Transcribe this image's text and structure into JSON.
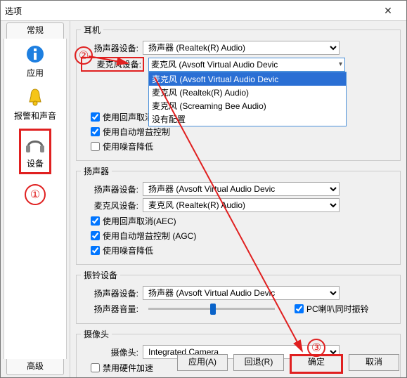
{
  "window": {
    "title": "选项"
  },
  "sidebar": {
    "tab_general": "常规",
    "tab_advanced": "高级",
    "items": [
      {
        "label": "应用"
      },
      {
        "label": "报警和声音"
      },
      {
        "label": "设备"
      }
    ]
  },
  "headset": {
    "title": "耳机",
    "speaker_label": "扬声器设备:",
    "speaker_value": "扬声器 (Realtek(R) Audio)",
    "mic_label": "麦克风设备:",
    "mic_value": "麦克风 (Avsoft Virtual Audio Devic",
    "mic_options": [
      "麦克风 (Avsoft Virtual Audio Devic",
      "麦克风 (Realtek(R) Audio)",
      "麦克风 (Screaming Bee Audio)",
      "没有配置"
    ],
    "aec": "使用回声取消(AEC",
    "agc": "使用自动增益控制",
    "nr": "使用噪音降低"
  },
  "speaker": {
    "title": "扬声器",
    "speaker_label": "扬声器设备:",
    "speaker_value": "扬声器 (Avsoft Virtual Audio Devic",
    "mic_label": "麦克风设备:",
    "mic_value": "麦克风 (Realtek(R) Audio)",
    "aec": "使用回声取消(AEC)",
    "agc": "使用自动增益控制 (AGC)",
    "nr": "使用噪音降低"
  },
  "ring": {
    "title": "振铃设备",
    "speaker_label": "扬声器设备:",
    "speaker_value": "扬声器 (Avsoft Virtual Audio Devic",
    "volume_label": "扬声器音量:",
    "pc_ring": "PC喇叭同时振铃"
  },
  "camera": {
    "title": "摄像头",
    "camera_label": "摄像头:",
    "camera_value": "Integrated Camera",
    "hwaccel": "禁用硬件加速"
  },
  "buttons": {
    "apply": "应用(A)",
    "back": "回退(R)",
    "ok": "确定",
    "cancel": "取消"
  },
  "annotations": {
    "n1": "①",
    "n2": "②",
    "n3": "③"
  }
}
